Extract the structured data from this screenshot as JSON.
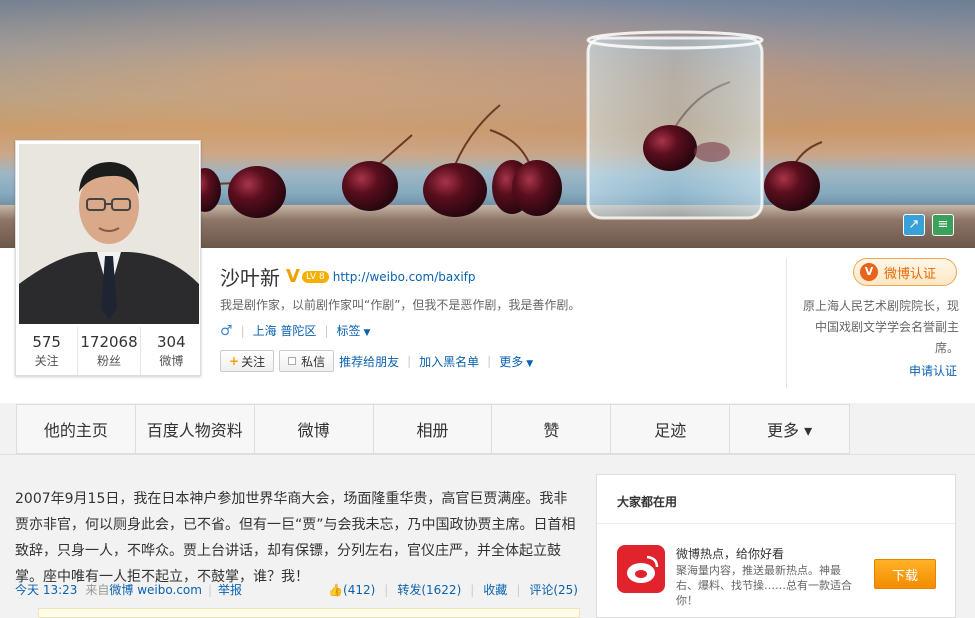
{
  "cover": {
    "icon_a": "↗",
    "icon_b": "≡"
  },
  "profile": {
    "name": "沙叶新",
    "verified_mark": "V",
    "level": "LV 8",
    "url": "http://weibo.com/baxifp",
    "bio": "我是剧作家，以前剧作家叫“作剧”，但我不是恶作剧，我是善作剧。",
    "gender_symbol": "♂",
    "location": "上海 普陀区",
    "tags_label": "标签",
    "actions": {
      "follow": "关注",
      "message": "私信",
      "recommend": "推荐给朋友",
      "blacklist": "加入黑名单",
      "more": "更多"
    },
    "stats": [
      {
        "num": "575",
        "label": "关注"
      },
      {
        "num": "172068",
        "label": "粉丝"
      },
      {
        "num": "304",
        "label": "微博"
      }
    ]
  },
  "verify": {
    "badge": "微博认证",
    "badge_letter": "V",
    "text": "原上海人民艺术剧院院长，现中国戏剧文学学会名誉副主席。",
    "apply": "申请认证"
  },
  "tabs": [
    "他的主页",
    "百度人物资料",
    "微博",
    "相册",
    "赞",
    "足迹",
    "更多 ▾"
  ],
  "post": {
    "text": "2007年9月15日，我在日本神户参加世界华商大会，场面隆重华贵，高官巨贾满座。我非贾亦非官，何以厕身此会，已不省。但有一巨“贾”与会我未忘，乃中国政协贾主席。日首相致辞，只身一人，不哗众。贾上台讲话，却有保镖，分列左右，官仪庄严，并全体起立鼓掌。座中唯有一人拒不起立，不鼓掌，谁？我！",
    "time": "今天 13:23",
    "from_label": "来自",
    "source": "微博 weibo.com",
    "report": "举报",
    "likes": "(412)",
    "repost": "转发(1622)",
    "favorite": "收藏",
    "comment": "评论(25)"
  },
  "sidebar": {
    "title": "大家都在用",
    "app_name": "微博热点，给你好看",
    "app_desc": "聚海量内容，推送最新热点。神最右、爆料、找节操……总有一款适合你！",
    "download": "下载"
  }
}
